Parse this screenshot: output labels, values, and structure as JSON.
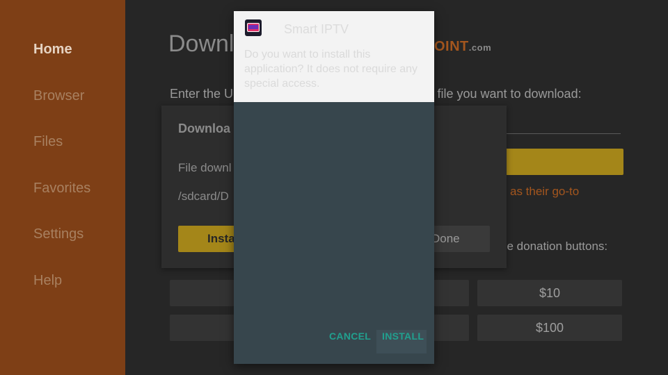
{
  "sidebar": {
    "items": [
      {
        "label": "Home",
        "active": true
      },
      {
        "label": "Browser",
        "active": false
      },
      {
        "label": "Files",
        "active": false
      },
      {
        "label": "Favorites",
        "active": false
      },
      {
        "label": "Settings",
        "active": false
      },
      {
        "label": "Help",
        "active": false
      }
    ]
  },
  "main": {
    "title": "Downl",
    "brand_main": "OINT",
    "brand_suffix": ".com",
    "url_instruction": "Enter the URL                                              r the file you want to download:",
    "goto_text": "as their go-to",
    "donation_text": "se donation buttons:",
    "donate_buttons": [
      "$10",
      "$100"
    ]
  },
  "download_dialog": {
    "title": "Downloa",
    "line1": "File downl",
    "line2": "/sdcard/D",
    "install_label": "Insta",
    "done_label": "Done"
  },
  "modal": {
    "app_name": "Smart IPTV",
    "message": "Do you want to install this application? It does not require any special access.",
    "cancel_label": "CANCEL",
    "install_label": "INSTALL"
  },
  "colors": {
    "sidebar_bg": "#7e3f16",
    "accent_yellow": "#a48619",
    "modal_button_teal": "#21a08f"
  }
}
